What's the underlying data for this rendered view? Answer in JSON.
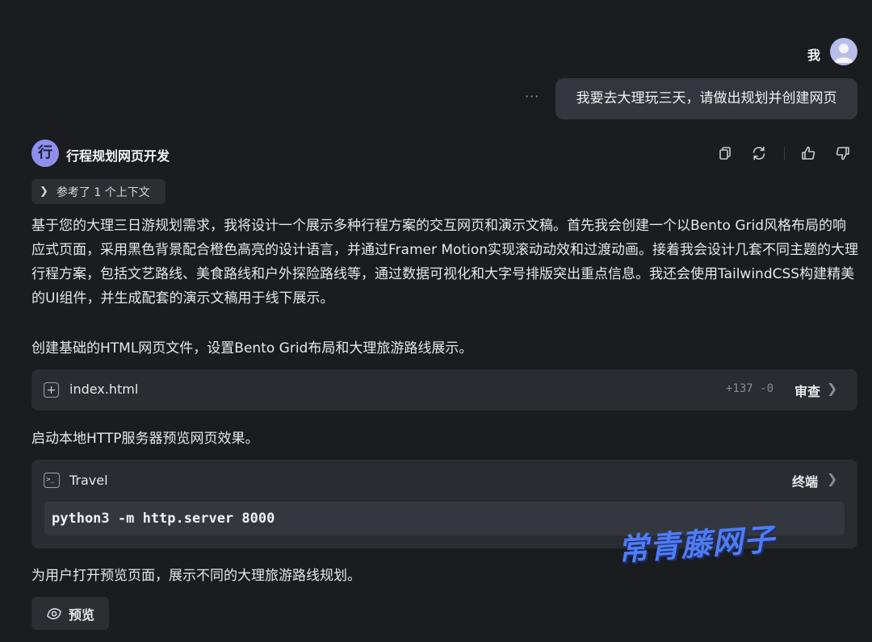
{
  "user": {
    "name": "我",
    "message": "我要去大理玩三天，请做出规划并创建网页"
  },
  "more_label": "···",
  "assistant": {
    "avatar_char": "行",
    "name": "行程规划网页开发",
    "ref_label": "参考了 1 个上下文"
  },
  "paragraphs": [
    "基于您的大理三日游规划需求，我将设计一个展示多种行程方案的交互网页和演示文稿。首先我会创建一个以Bento Grid风格布局的响应式页面，采用黑色背景配合橙色高亮的设计语言，并通过Framer Motion实现滚动动效和过渡动画。接着我会设计几套不同主题的大理行程方案，包括文艺路线、美食路线和户外探险路线等，通过数据可视化和大字号排版突出重点信息。我还会使用TailwindCSS构建精美的UI组件，并生成配套的演示文稿用于线下展示。",
    "创建基础的HTML网页文件，设置Bento Grid布局和大理旅游路线展示。",
    "启动本地HTTP服务器预览网页效果。",
    "为用户打开预览页面，展示不同的大理旅游路线规划。"
  ],
  "file_card": {
    "icon": "plus-square-icon",
    "filename": "index.html",
    "diff": "+137 -0",
    "action": "审查"
  },
  "terminal_card": {
    "icon": "terminal-icon",
    "name": "Travel",
    "action": "终端",
    "command": "python3 -m http.server 8000"
  },
  "preview_button": {
    "icon": "eye-icon",
    "label": "预览"
  },
  "watermark": "常青藤网子",
  "icons": [
    "copy-icon",
    "refresh-icon",
    "thumbs-up-icon",
    "thumbs-down-icon"
  ],
  "colors": {
    "background": "#1b1c20",
    "card": "#2a2c32",
    "bot_avatar": "#8f8ff0",
    "watermark": "#4f7cf2"
  }
}
